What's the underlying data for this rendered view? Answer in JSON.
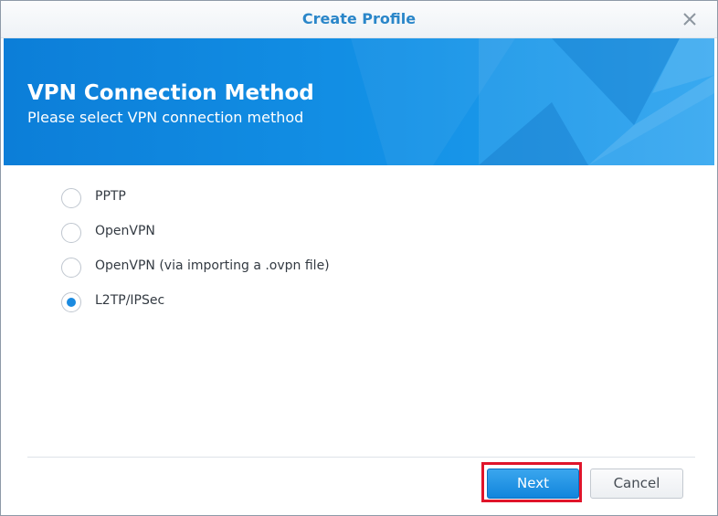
{
  "window": {
    "title": "Create Profile"
  },
  "banner": {
    "title": "VPN Connection Method",
    "subtitle": "Please select VPN connection method"
  },
  "options": [
    {
      "label": "PPTP",
      "checked": false
    },
    {
      "label": "OpenVPN",
      "checked": false
    },
    {
      "label": "OpenVPN (via importing a .ovpn file)",
      "checked": false
    },
    {
      "label": "L2TP/IPSec",
      "checked": true
    }
  ],
  "buttons": {
    "next_label": "Next",
    "cancel_label": "Cancel"
  },
  "icons": {
    "close": "close-icon"
  },
  "colors": {
    "title": "#2a86c9",
    "banner": "#1391e6",
    "accent": "#1a8ae0",
    "highlight": "#e0142a"
  }
}
